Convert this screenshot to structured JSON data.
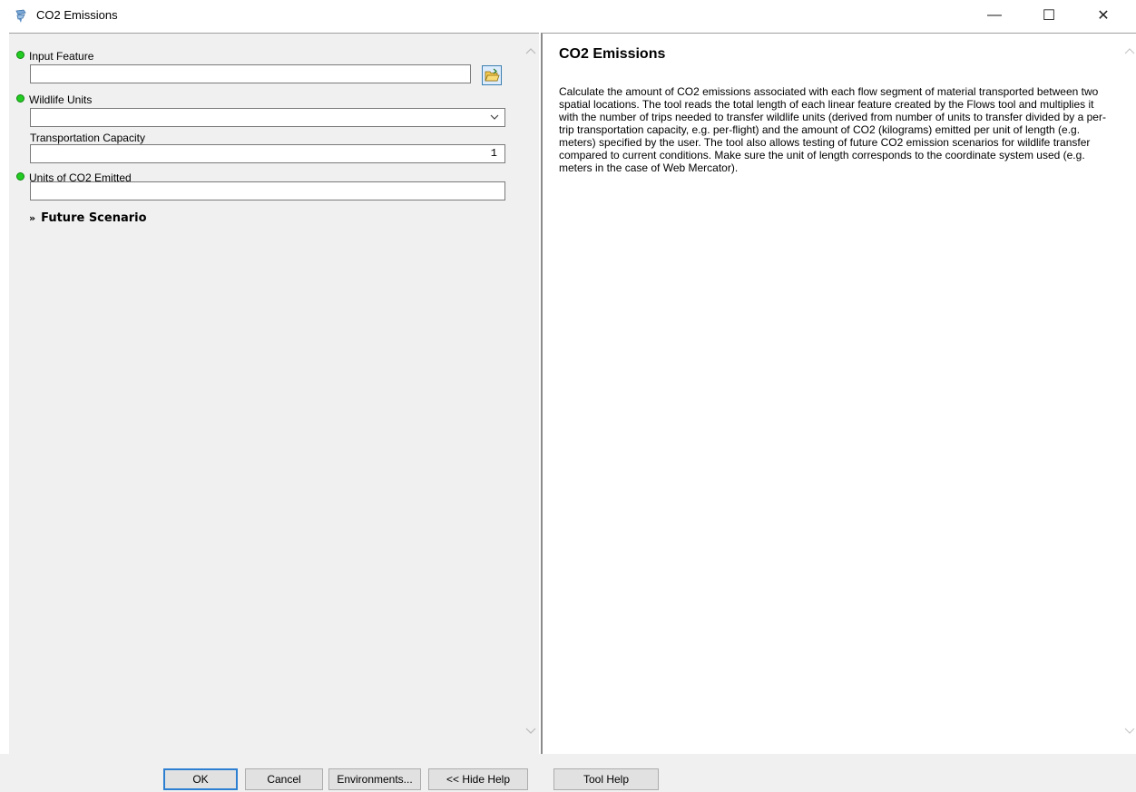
{
  "window": {
    "title": "CO2 Emissions",
    "controls": {
      "minimize": "—",
      "maximize": "☐",
      "close": "✕"
    }
  },
  "form": {
    "fields": [
      {
        "label": "Input Feature",
        "required": true,
        "value": ""
      },
      {
        "label": "Wildlife Units",
        "required": true,
        "value": ""
      },
      {
        "label": "Transportation Capacity",
        "required": false,
        "value": "1"
      },
      {
        "label": "Units of CO2 Emitted",
        "required": true,
        "value": ""
      }
    ],
    "section": {
      "label": "Future Scenario",
      "collapsed": true
    }
  },
  "help": {
    "title": "CO2 Emissions",
    "body": "Calculate the amount of CO2 emissions associated with each flow segment of material transported between two spatial locations. The tool reads the total length of each linear feature created by the Flows tool and multiplies it with the number of trips needed to transfer wildlife units (derived from number of units to transfer divided by a per-trip transportation capacity, e.g. per-flight) and the amount of CO2 (kilograms) emitted per unit of length (e.g. meters) specified by the user. The tool also allows testing of future CO2 emission scenarios for wildlife transfer compared to current conditions. Make sure the unit of length corresponds to the coordinate system used (e.g. meters in the case of Web Mercator)."
  },
  "buttons": {
    "ok": "OK",
    "cancel": "Cancel",
    "environments": "Environments...",
    "hide_help": "<< Hide Help",
    "tool_help": "Tool Help"
  },
  "colors": {
    "required_dot": "#22cc22",
    "accent": "#2d7fd1",
    "panel": "#f0f0f0"
  },
  "icons": [
    "tool-icon",
    "folder-open-icon",
    "chevron-down-icon",
    "expand-chevron-icon",
    "scroll-up-icon",
    "scroll-down-icon"
  ]
}
